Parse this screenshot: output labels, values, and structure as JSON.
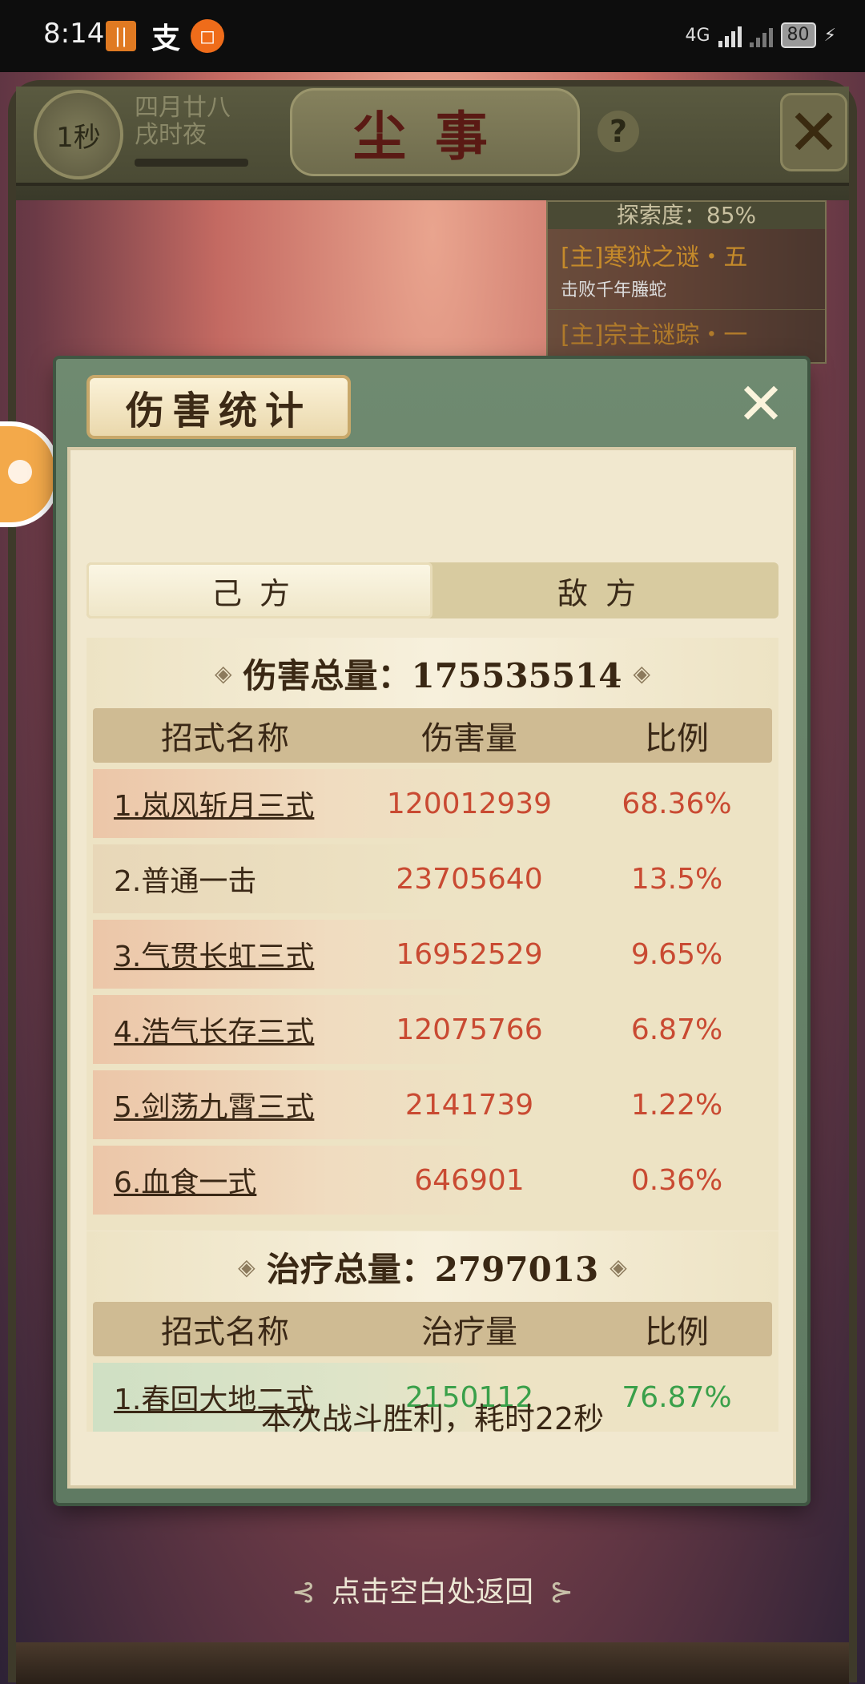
{
  "status_bar": {
    "time": "8:14",
    "network": "4G",
    "battery": "80",
    "notif_app": "支"
  },
  "game": {
    "timer": "1秒",
    "date_line1": "四月廿八",
    "date_line2": "戌时夜",
    "scene_title": "尘事",
    "help": "?",
    "close": "✕",
    "quest": {
      "explore_label": "探索度：85%",
      "quest1_title": "[主]寒狱之谜・五",
      "quest1_desc": "击败千年螣蛇",
      "quest2_title": "[主]宗主谜踪・一"
    }
  },
  "modal": {
    "title": "伤害统计",
    "close": "✕",
    "tabs": {
      "self": "己方",
      "enemy": "敌方"
    },
    "damage": {
      "header": "伤害总量：175535514",
      "columns": {
        "name": "招式名称",
        "value": "伤害量",
        "ratio": "比例"
      },
      "rows": [
        {
          "name": "1.岚风斩月三式",
          "value": "120012939",
          "ratio": "68.36%"
        },
        {
          "name": "2.普通一击",
          "value": "23705640",
          "ratio": "13.5%"
        },
        {
          "name": "3.气贯长虹三式",
          "value": "16952529",
          "ratio": "9.65%"
        },
        {
          "name": "4.浩气长存三式",
          "value": "12075766",
          "ratio": "6.87%"
        },
        {
          "name": "5.剑荡九霄三式",
          "value": "2141739",
          "ratio": "1.22%"
        },
        {
          "name": "6.血食一式",
          "value": "646901",
          "ratio": "0.36%"
        }
      ]
    },
    "healing": {
      "header": "治疗总量：2797013",
      "columns": {
        "name": "招式名称",
        "value": "治疗量",
        "ratio": "比例"
      },
      "rows": [
        {
          "name": "1.春回大地二式",
          "value": "2150112",
          "ratio": "76.87%"
        }
      ]
    },
    "result": "本次战斗胜利，耗时22秒"
  },
  "footer": {
    "hint": "点击空白处返回"
  },
  "colors": {
    "damage_value": "#c94a32",
    "heal_value": "#3aa04a",
    "modal_frame": "#6f8a70",
    "parchment": "#ede3c4"
  }
}
